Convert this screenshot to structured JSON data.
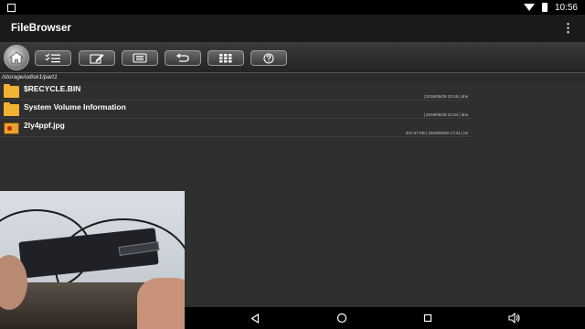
{
  "status_bar": {
    "time": "10:56",
    "icons": [
      "square-icon",
      "wifi-icon",
      "battery-icon"
    ]
  },
  "app_bar": {
    "title": "FileBrowser",
    "menu_icon": "kebab-menu-icon",
    "menu_glyph": "⋮"
  },
  "toolbar": {
    "buttons": [
      "home-icon",
      "multi-select-icon",
      "edit-icon",
      "list-view-icon",
      "back-icon",
      "grid-view-icon",
      "help-icon"
    ]
  },
  "path": "/storage/udisk1/part1",
  "files": [
    {
      "name": "$RECYCLE.BIN",
      "meta": "| 2016/06/28 22:45 | drw",
      "type": "folder"
    },
    {
      "name": "System Volume Information",
      "meta": "| 2016/06/28 22:34 | drw",
      "type": "folder"
    },
    {
      "name": "2ly4ppf.jpg",
      "meta": "347.67 KB | 2016/06/30 17:41 | rw",
      "type": "image"
    }
  ],
  "navbar": {
    "buttons": [
      "back-icon",
      "home-icon",
      "recents-icon",
      "volume-icon"
    ]
  },
  "colors": {
    "background": "#2f2f2f",
    "toolbar": "#3b3b3b",
    "folder": "#f2b233"
  }
}
